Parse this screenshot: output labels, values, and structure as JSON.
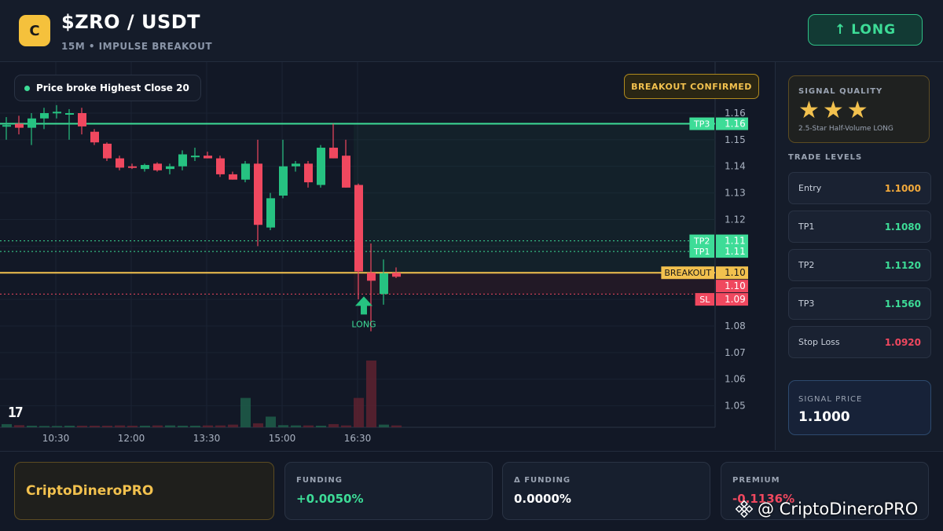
{
  "header": {
    "coin_letter": "C",
    "pair": "$ZRO / USDT",
    "subtitle": "15M • IMPULSE BREAKOUT",
    "signal_button": "LONG",
    "signal_arrow": "↑"
  },
  "chart": {
    "broke_badge": "Price broke Highest Close 20",
    "confirmed_badge": "BREAKOUT CONFIRMED",
    "tv_logo": "17",
    "long_marker_label": "LONG",
    "price_axis": [
      "1.16",
      "1.15",
      "1.14",
      "1.13",
      "1.12",
      "1.11",
      "1.10",
      "1.09",
      "1.08",
      "1.07",
      "1.06",
      "1.05"
    ],
    "time_axis": [
      "10:30",
      "12:00",
      "13:30",
      "15:00",
      "16:30"
    ],
    "level_tags": [
      {
        "name": "TP3",
        "value": "1.16",
        "color": "#3ddc97"
      },
      {
        "name": "TP2",
        "value": "1.11",
        "color": "#3ddc97"
      },
      {
        "name": "TP1",
        "value": "1.11",
        "color": "#3ddc97"
      },
      {
        "name": "BREAKOUT",
        "value": "1.10",
        "color": "#f2c14e"
      },
      {
        "name": "",
        "value": "1.10",
        "color": "#f0485f"
      },
      {
        "name": "SL",
        "value": "1.09",
        "color": "#f0485f"
      }
    ],
    "candles": [
      {
        "o": 1.1555,
        "h": 1.1585,
        "l": 1.15,
        "c": 1.1555
      },
      {
        "o": 1.156,
        "h": 1.159,
        "l": 1.152,
        "c": 1.1545
      },
      {
        "o": 1.1545,
        "h": 1.16,
        "l": 1.148,
        "c": 1.158
      },
      {
        "o": 1.158,
        "h": 1.162,
        "l": 1.154,
        "c": 1.16
      },
      {
        "o": 1.16,
        "h": 1.163,
        "l": 1.158,
        "c": 1.1605
      },
      {
        "o": 1.16,
        "h": 1.1615,
        "l": 1.15,
        "c": 1.16
      },
      {
        "o": 1.16,
        "h": 1.162,
        "l": 1.152,
        "c": 1.155
      },
      {
        "o": 1.153,
        "h": 1.154,
        "l": 1.148,
        "c": 1.149
      },
      {
        "o": 1.1485,
        "h": 1.149,
        "l": 1.142,
        "c": 1.143
      },
      {
        "o": 1.143,
        "h": 1.144,
        "l": 1.1385,
        "c": 1.1395
      },
      {
        "o": 1.14,
        "h": 1.141,
        "l": 1.139,
        "c": 1.1395
      },
      {
        "o": 1.139,
        "h": 1.141,
        "l": 1.138,
        "c": 1.1405
      },
      {
        "o": 1.141,
        "h": 1.1415,
        "l": 1.138,
        "c": 1.1385
      },
      {
        "o": 1.139,
        "h": 1.141,
        "l": 1.137,
        "c": 1.14
      },
      {
        "o": 1.14,
        "h": 1.146,
        "l": 1.1385,
        "c": 1.1445
      },
      {
        "o": 1.144,
        "h": 1.147,
        "l": 1.142,
        "c": 1.144
      },
      {
        "o": 1.144,
        "h": 1.1455,
        "l": 1.143,
        "c": 1.143
      },
      {
        "o": 1.143,
        "h": 1.144,
        "l": 1.136,
        "c": 1.137
      },
      {
        "o": 1.137,
        "h": 1.138,
        "l": 1.135,
        "c": 1.135
      },
      {
        "o": 1.135,
        "h": 1.142,
        "l": 1.134,
        "c": 1.141
      },
      {
        "o": 1.141,
        "h": 1.15,
        "l": 1.11,
        "c": 1.118
      },
      {
        "o": 1.117,
        "h": 1.13,
        "l": 1.116,
        "c": 1.128
      },
      {
        "o": 1.129,
        "h": 1.15,
        "l": 1.128,
        "c": 1.14
      },
      {
        "o": 1.14,
        "h": 1.142,
        "l": 1.138,
        "c": 1.141
      },
      {
        "o": 1.141,
        "h": 1.142,
        "l": 1.132,
        "c": 1.134
      },
      {
        "o": 1.133,
        "h": 1.148,
        "l": 1.132,
        "c": 1.147
      },
      {
        "o": 1.147,
        "h": 1.156,
        "l": 1.143,
        "c": 1.143
      },
      {
        "o": 1.144,
        "h": 1.15,
        "l": 1.132,
        "c": 1.132
      },
      {
        "o": 1.133,
        "h": 1.1335,
        "l": 1.09,
        "c": 1.1005
      },
      {
        "o": 1.1,
        "h": 1.111,
        "l": 1.078,
        "c": 1.097
      },
      {
        "o": 1.092,
        "h": 1.105,
        "l": 1.088,
        "c": 1.0998
      },
      {
        "o": 1.1,
        "h": 1.102,
        "l": 1.098,
        "c": 1.0985
      }
    ],
    "volumes": [
      1.2,
      0.8,
      0.6,
      0.5,
      0.5,
      0.6,
      0.6,
      0.6,
      0.6,
      0.7,
      0.6,
      0.6,
      0.7,
      0.7,
      0.6,
      0.6,
      0.7,
      0.7,
      1.0,
      11.0,
      1.5,
      4.0,
      0.8,
      0.7,
      0.7,
      0.6,
      1.2,
      0.7,
      11.0,
      25.0,
      1.0,
      0.7
    ]
  },
  "signal_quality": {
    "label": "SIGNAL QUALITY",
    "stars": "★★★",
    "description": "2.5-Star Half-Volume LONG"
  },
  "trade_levels": {
    "heading": "TRADE LEVELS",
    "rows": [
      {
        "name": "Entry",
        "value": "1.1000",
        "color": "#f2a93b"
      },
      {
        "name": "TP1",
        "value": "1.1080",
        "color": "#3ddc97"
      },
      {
        "name": "TP2",
        "value": "1.1120",
        "color": "#3ddc97"
      },
      {
        "name": "TP3",
        "value": "1.1560",
        "color": "#3ddc97"
      },
      {
        "name": "Stop Loss",
        "value": "1.0920",
        "color": "#f0485f"
      }
    ]
  },
  "signal_price": {
    "label": "SIGNAL PRICE",
    "value": "1.1000"
  },
  "footer": {
    "brand": "CriptoDineroPRO",
    "funding_label": "FUNDING",
    "funding_value": "+0.0050%",
    "delta_label": "Δ FUNDING",
    "delta_value": "0.0000%",
    "premium_label": "PREMIUM",
    "premium_value": "-0.1136%",
    "watermark": "@ CriptoDineroPRO"
  },
  "colors": {
    "bull": "#26c281",
    "bear": "#f0485f",
    "accent": "#f2c14e"
  }
}
